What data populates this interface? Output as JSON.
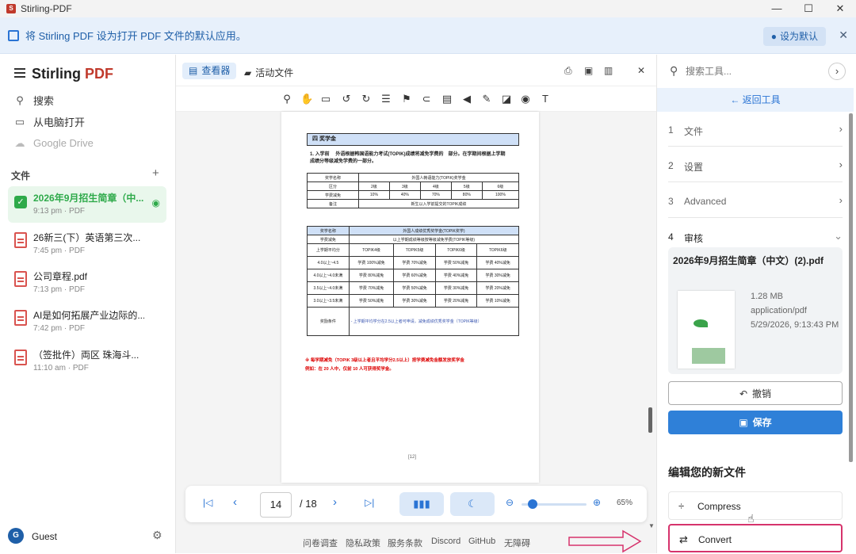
{
  "window": {
    "title": "Stirling-PDF",
    "minimize": "—",
    "maximize": "☐",
    "close": "✕"
  },
  "banner": {
    "text": "将 Stirling PDF 设为打开 PDF 文件的默认应用。",
    "button": "设为默认",
    "close": "✕"
  },
  "sidebar": {
    "brand_a": "Stirling ",
    "brand_b": "PDF",
    "nav": [
      {
        "label": "搜索",
        "icon": "search-icon"
      },
      {
        "label": "从电脑打开",
        "icon": "folder-icon"
      },
      {
        "label": "Google Drive",
        "icon": "cloud-icon"
      }
    ],
    "files_heading": "文件",
    "add": "+",
    "files": [
      {
        "name": "2026年9月招生简章（中...",
        "meta": "9:13 pm · PDF"
      },
      {
        "name": "26新三(下）英语第三次...",
        "meta": "7:45 pm · PDF"
      },
      {
        "name": "公司章程.pdf",
        "meta": "7:13 pm · PDF"
      },
      {
        "name": "AI是如何拓展产业边际的...",
        "meta": "7:42 pm · PDF"
      },
      {
        "name": "（签批件）両区 珠海斗...",
        "meta": "11:10 am · PDF"
      }
    ],
    "user": {
      "initial": "G",
      "name": "Guest"
    }
  },
  "viewer": {
    "tab_viewer": "查看器",
    "tab_active": "活动文件",
    "page_header": "四 奖学金",
    "page_para": "1. 入学前 　外语根据韩国语能力考试(TOPIK)成绩将减免学费的　部分。在学期间根据上学期成绩分等级减免学费的一部分。",
    "table1": [
      [
        "奖学名称",
        "外国人韩语能力(TOPIK)奖学金"
      ],
      [
        "区分",
        "2级",
        "3级",
        "4级",
        "5级",
        "6级"
      ],
      [
        "学费减免",
        "10%",
        "40%",
        "70%",
        "80%",
        "100%"
      ],
      [
        "备注",
        "新生以入学前提交的TOPIK成绩"
      ]
    ],
    "table2": [
      [
        "奖学名称",
        "外国人成绩优秀奖学金(TOPIK奖学)"
      ],
      [
        "学费减免",
        "以上学期成绩等级按等级减免学费(TOPIK等级)"
      ],
      [
        "上学期平均分",
        "TOPIK4级",
        "TOPIK5级",
        "TOPIK6级",
        "TOPIK6级"
      ],
      [
        "4.0以上~4.5",
        "学费 100%减免",
        "学费 70%减免",
        "学费 50%减免",
        "学费 40%减免"
      ],
      [
        "4.0以上~4.0未满",
        "学费 80%减免",
        "学费 60%减免",
        "学费 40%减免",
        "学费 30%减免"
      ],
      [
        "3.5以上~4.0未满",
        "学费 70%减免",
        "学费 50%减免",
        "学费 30%减免",
        "学费 20%减免"
      ],
      [
        "3.0以上~3.5未满",
        "学费 50%减免",
        "学费 30%减免",
        "学费 20%减免",
        "学费 10%减免"
      ],
      [
        "奖励条件",
        "- 上学期平均学分在2.5以上者可申请，减免成绩优秀奖学金（TOPIK等级）"
      ]
    ],
    "note1": "※ 每学期减免（TOPIK 3级以上者且平均学分2.5以上）按学费减免金额发放奖学金",
    "note2": "例如：在 20 人中，仅前 10 人可获得奖学金。",
    "page_footer": "[12]",
    "pager": {
      "current": "14",
      "total": "/ 18",
      "zoom": "65%",
      "zoom_fraction": 0.12
    },
    "footer_links": [
      "问卷调查",
      "隐私政策",
      "服务条款",
      "Discord",
      "GitHub",
      "无障碍"
    ]
  },
  "right": {
    "search_placeholder": "搜索工具...",
    "back": "← 返回工具",
    "steps": [
      {
        "num": "1",
        "label": "文件",
        "chev": "›"
      },
      {
        "num": "2",
        "label": "设置",
        "chev": "›"
      },
      {
        "num": "3",
        "label": "Advanced",
        "chev": "›"
      },
      {
        "num": "4",
        "label": "审核",
        "chev": "⌄"
      }
    ],
    "review": {
      "filename": "2026年9月招生简章（中文）(2).pdf",
      "size": "1.28 MB",
      "type": "application/pdf",
      "date": "5/29/2026, 9:13:43 PM"
    },
    "undo": "撤销",
    "save": "保存",
    "edit_heading": "编辑您的新文件",
    "tools": [
      {
        "label": "Compress",
        "icon": "compress-icon"
      },
      {
        "label": "Convert",
        "icon": "convert-icon"
      }
    ]
  },
  "colors": {
    "accent": "#2a74d4",
    "save": "#2f80d8",
    "highlight": "#d6336c",
    "brand_pdf": "#c0392b",
    "selected_file_bg": "#e9f7ec"
  }
}
